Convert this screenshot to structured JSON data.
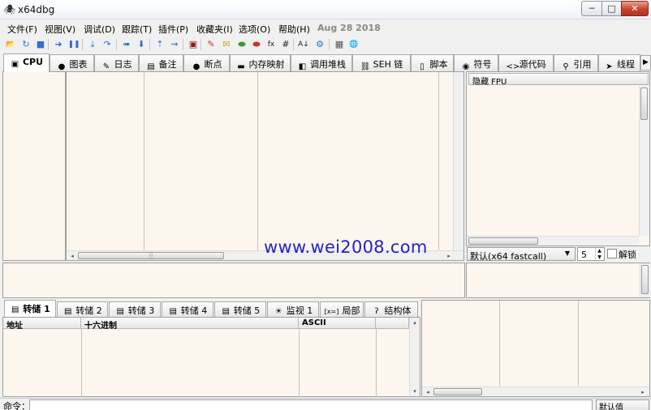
{
  "window": {
    "title": "x64dbg",
    "app_icon": "bug-icon",
    "controls": {
      "minimize": "─",
      "maximize": "□",
      "close": "✕"
    }
  },
  "menu": {
    "items": [
      "文件(F)",
      "视图(V)",
      "调试(D)",
      "跟踪(T)",
      "插件(P)",
      "收藏夹(I)",
      "选项(O)",
      "帮助(H)"
    ],
    "build_date": "Aug 28 2018"
  },
  "toolbar": {
    "icons": [
      {
        "name": "open-icon",
        "glyph": "📂",
        "color": "#d9a520"
      },
      {
        "name": "restart-icon",
        "glyph": "↻",
        "color": "#2b7bd0"
      },
      {
        "name": "stop-icon",
        "glyph": "■",
        "color": "#2f6fd0"
      },
      {
        "name": "run-icon",
        "glyph": "➜",
        "color": "#2f6fd0"
      },
      {
        "name": "pause-icon",
        "glyph": "❚❚",
        "color": "#2f6fd0"
      },
      {
        "name": "step-into-icon",
        "glyph": "⤓",
        "color": "#2f6fd0"
      },
      {
        "name": "step-over-icon",
        "glyph": "↷",
        "color": "#2f6fd0"
      },
      {
        "name": "trace-into-icon",
        "glyph": "➠",
        "color": "#2f6fd0"
      },
      {
        "name": "trace-over-icon",
        "glyph": "⬇",
        "color": "#2f6fd0"
      },
      {
        "name": "execute-till-return-icon",
        "glyph": "⇡",
        "color": "#2f6fd0"
      },
      {
        "name": "run-to-user-code-icon",
        "glyph": "⇝",
        "color": "#2f6fd0"
      },
      {
        "name": "scylla-icon",
        "glyph": "▣",
        "color": "#8b1a1a"
      },
      {
        "name": "patch-icon",
        "glyph": "✎",
        "color": "#c0392b"
      },
      {
        "name": "comment-icon",
        "glyph": "✉",
        "color": "#d4a017"
      },
      {
        "name": "label-icon",
        "glyph": "⬬",
        "color": "#3a9a3a"
      },
      {
        "name": "bookmark-icon",
        "glyph": "⬬",
        "color": "#c0392b"
      },
      {
        "name": "function-icon",
        "glyph": "fx",
        "color": "#222222"
      },
      {
        "name": "hash-icon",
        "glyph": "#",
        "color": "#222222"
      },
      {
        "name": "font-icon",
        "glyph": "A↓",
        "color": "#222222"
      },
      {
        "name": "settings-icon",
        "glyph": "⚙",
        "color": "#2f6fd0"
      },
      {
        "name": "calculator-icon",
        "glyph": "▦",
        "color": "#555555"
      },
      {
        "name": "globe-icon",
        "glyph": "🌐",
        "color": "#2a7ad0"
      }
    ]
  },
  "tabs": [
    {
      "label": "CPU",
      "icon": "cpu-icon",
      "glyph": "▣",
      "active": true
    },
    {
      "label": "图表",
      "icon": "graph-icon",
      "glyph": "●"
    },
    {
      "label": "日志",
      "icon": "log-icon",
      "glyph": "✎"
    },
    {
      "label": "备注",
      "icon": "notes-icon",
      "glyph": "▤"
    },
    {
      "label": "断点",
      "icon": "breakpoint-icon",
      "glyph": "●"
    },
    {
      "label": "内存映射",
      "icon": "memory-map-icon",
      "glyph": "▬"
    },
    {
      "label": "调用堆栈",
      "icon": "call-stack-icon",
      "glyph": "◧"
    },
    {
      "label": "SEH 链",
      "icon": "seh-chain-icon",
      "glyph": "⛓"
    },
    {
      "label": "脚本",
      "icon": "script-icon",
      "glyph": "▯"
    },
    {
      "label": "符号",
      "icon": "symbols-icon",
      "glyph": "◉"
    },
    {
      "label": "源代码",
      "icon": "source-icon",
      "glyph": "<>"
    },
    {
      "label": "引用",
      "icon": "references-icon",
      "glyph": "⚲"
    },
    {
      "label": "线程",
      "icon": "threads-icon",
      "glyph": "➤"
    }
  ],
  "registers": {
    "hide_fpu_label": "隐藏 FPU",
    "calling_convention": "默认(x64 fastcall)",
    "arg_count": "5",
    "lock_label": "解锁"
  },
  "dump_tabs": [
    {
      "label": "转储 1",
      "icon": "dump-icon",
      "glyph": "▤",
      "active": true
    },
    {
      "label": "转储 2",
      "icon": "dump-icon",
      "glyph": "▤"
    },
    {
      "label": "转储 3",
      "icon": "dump-icon",
      "glyph": "▤"
    },
    {
      "label": "转储 4",
      "icon": "dump-icon",
      "glyph": "▤"
    },
    {
      "label": "转储 5",
      "icon": "dump-icon",
      "glyph": "▤"
    },
    {
      "label": "监视 1",
      "icon": "watch-icon",
      "glyph": "☀"
    },
    {
      "label": "局部",
      "icon": "locals-icon",
      "glyph": "[x=]"
    },
    {
      "label": "结构体",
      "icon": "struct-icon",
      "glyph": "ʔ"
    }
  ],
  "dump_columns": [
    "地址",
    "十六进制",
    "ASCII"
  ],
  "watermark": "www.wei2008.com",
  "command": {
    "label": "命令：",
    "default_value": "默认值"
  },
  "colors": {
    "pane_bg": "#fdf6ee",
    "chrome_bg": "#f0f0f0",
    "watermark": "#2222cc"
  }
}
